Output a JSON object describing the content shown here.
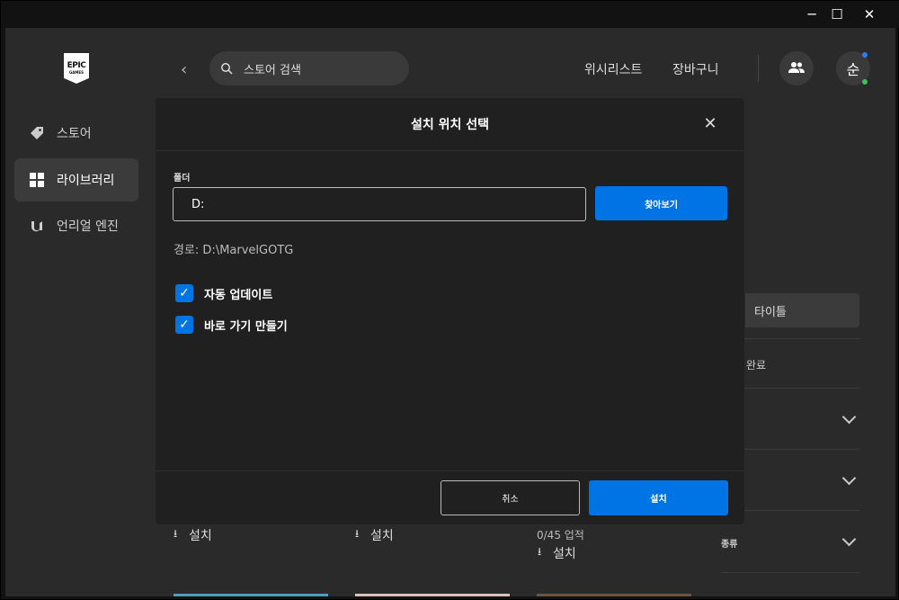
{
  "window": {
    "minimize": "─",
    "maximize": "☐",
    "close": "✕"
  },
  "logo": {
    "line1": "EPIC",
    "line2": "GAMES"
  },
  "sidebar": {
    "items": [
      {
        "label": "스토어",
        "icon": "tag-icon"
      },
      {
        "label": "라이브러리",
        "icon": "grid-icon",
        "active": true
      },
      {
        "label": "언리얼 엔진",
        "icon": "unreal-icon"
      }
    ]
  },
  "header": {
    "search_placeholder": "스토어 검색",
    "wishlist": "위시리스트",
    "cart": "장바구니",
    "avatar": "순"
  },
  "filters": {
    "tab_label": "타이틀",
    "completed_label": "완료",
    "genre_label": "종류"
  },
  "library": {
    "install_label": "설치",
    "achievements": "0/45 업적"
  },
  "modal": {
    "title": "설치 위치 선택",
    "folder_label": "폴더",
    "folder_value": "D:",
    "browse_button": "찾아보기",
    "path_text": "경로: D:\\MarvelGOTG",
    "checkboxes": [
      {
        "label": "자동 업데이트",
        "checked": true
      },
      {
        "label": "바로 가기 만들기",
        "checked": true
      }
    ],
    "cancel_button": "취소",
    "install_button": "설치"
  },
  "colors": {
    "accent": "#0074e4",
    "background": "#121212",
    "panel": "#2a2a2a",
    "modal": "#202020"
  }
}
